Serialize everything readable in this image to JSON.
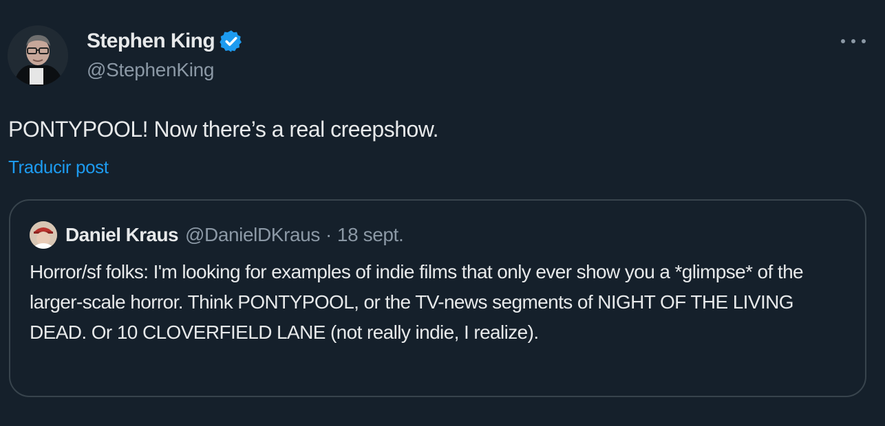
{
  "tweet": {
    "author": {
      "display_name": "Stephen King",
      "handle": "@StephenKing",
      "verified_icon": "verified-badge-icon",
      "verified_color": "#1d9bf0"
    },
    "more_icon": "more-dots-icon",
    "text": "PONTYPOOL! Now there’s a real creepshow.",
    "translate_label": "Traducir post"
  },
  "quote": {
    "author": {
      "display_name": "Daniel Kraus",
      "handle": "@DanielDKraus",
      "separator": "·",
      "date": "18 sept."
    },
    "text": "Horror/sf folks: I'm looking for examples of indie films that only ever show you a *glimpse* of the larger-scale horror. Think PONTYPOOL, or the TV-news segments of NIGHT OF THE LIVING DEAD. Or 10 CLOVERFIELD LANE (not really indie, I realize)."
  },
  "colors": {
    "background": "#15202b",
    "text_primary": "#e7e9ea",
    "text_secondary": "#8b98a5",
    "accent": "#1d9bf0",
    "border": "#38444d"
  }
}
